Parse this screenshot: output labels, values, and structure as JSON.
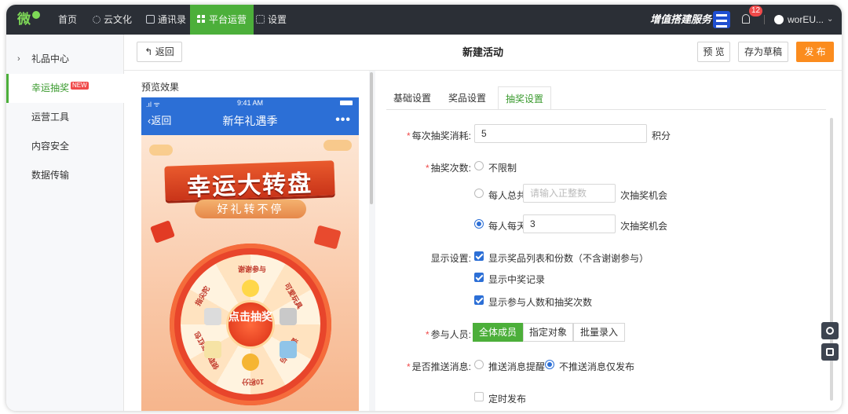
{
  "topbar": {
    "nav": [
      {
        "label": "首页",
        "icon": "none"
      },
      {
        "label": "云文化",
        "icon": "sun-icon"
      },
      {
        "label": "通讯录",
        "icon": "contacts-icon"
      },
      {
        "label": "平台运营",
        "icon": "grid-icon",
        "active": true
      },
      {
        "label": "设置",
        "icon": "grid-icon"
      }
    ],
    "value_added": "增值搭建服务",
    "notification_count": "12",
    "user_name": "worEU..."
  },
  "sidebar": {
    "items": [
      {
        "label": "礼品中心",
        "caret": "›"
      },
      {
        "label": "幸运抽奖",
        "badge": "NEW",
        "active": true
      },
      {
        "label": "运营工具"
      },
      {
        "label": "内容安全"
      },
      {
        "label": "数据传输"
      }
    ]
  },
  "header": {
    "back": "返回",
    "title": "新建活动",
    "preview": "预 览",
    "save_draft": "存为草稿",
    "publish": "发 布"
  },
  "preview": {
    "label": "预览效果",
    "status_time": "9:41 AM",
    "nav_back": "返回",
    "nav_title": "新年礼遇季",
    "banner": "幸运大转盘",
    "subtitle": "好礼转不停",
    "center": "点击抽奖",
    "sectors": [
      "谢谢参与",
      "可爱玩具",
      "谢谢参与",
      "10积分",
      "领取新年红包",
      "指尖陀"
    ]
  },
  "settings": {
    "tabs": [
      {
        "label": "基础设置"
      },
      {
        "label": "奖品设置"
      },
      {
        "label": "抽奖设置",
        "active": true
      }
    ],
    "cost": {
      "label": "每次抽奖消耗:",
      "value": "5",
      "unit": "积分"
    },
    "times": {
      "label": "抽奖次数:",
      "unlimited": "不限制",
      "per_total": "每人总共",
      "per_total_placeholder": "请输入正整数",
      "per_total_unit": "次抽奖机会",
      "per_day": "每人每天",
      "per_day_value": "3",
      "per_day_unit": "次抽奖机会",
      "selected": "per_day"
    },
    "display": {
      "label": "显示设置:",
      "options": [
        {
          "label": "显示奖品列表和份数（不含谢谢参与）",
          "checked": true
        },
        {
          "label": "显示中奖记录",
          "checked": true
        },
        {
          "label": "显示参与人数和抽奖次数",
          "checked": true
        }
      ]
    },
    "participants": {
      "label": "参与人员:",
      "options": [
        "全体成员",
        "指定对象",
        "批量录入"
      ],
      "selected": "全体成员"
    },
    "push": {
      "label": "是否推送消息:",
      "push_remind": "推送消息提醒",
      "publish_only": "不推送消息仅发布",
      "selected": "publish_only"
    },
    "scheduled": {
      "label": "定时发布",
      "checked": false
    }
  },
  "colors": {
    "accent_green": "#4caf3a",
    "publish_orange": "#fb8c1e",
    "topbar": "#2b2f36",
    "phone_blue": "#2c6fd6"
  }
}
